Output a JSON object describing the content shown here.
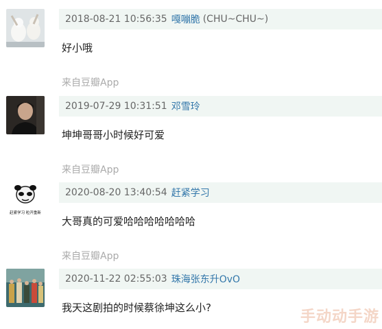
{
  "comments": [
    {
      "time": "2018-08-21 10:56:35",
      "user": "嘎嘣脆",
      "user_suffix": "(CHU~CHU~)",
      "text": "好小哦",
      "source": "来自豆瓣App",
      "avatar": "cat-photo"
    },
    {
      "time": "2019-07-29 10:31:51",
      "user": "邓雪玲",
      "user_suffix": "",
      "text": "坤坤哥哥小时候好可爱",
      "source": "来自豆瓣App",
      "avatar": "person-photo"
    },
    {
      "time": "2020-08-20 13:40:54",
      "user": "赶紧学习",
      "user_suffix": "",
      "text": "大哥真的可爱哈哈哈哈哈哈哈",
      "source": "来自豆瓣App",
      "avatar": "panda-meme",
      "avatar_caption": "赶紧学习 粒开重新"
    },
    {
      "time": "2020-11-22 02:55:03",
      "user": "珠海张东升OvO",
      "user_suffix": "",
      "text": "我天这剧拍的时候蔡徐坤这么小?",
      "source": "",
      "avatar": "group-photo"
    }
  ],
  "watermark": "手动动手游"
}
